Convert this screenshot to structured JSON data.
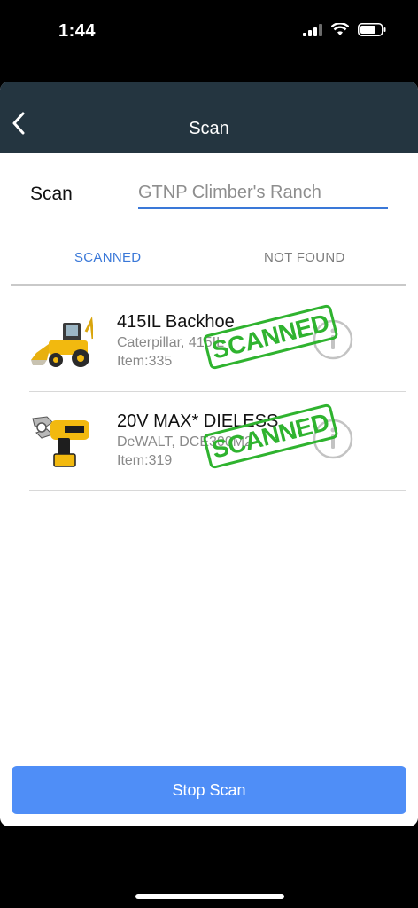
{
  "status": {
    "time": "1:44"
  },
  "nav": {
    "title": "Scan"
  },
  "scan": {
    "label": "Scan",
    "placeholder": "GTNP Climber's Ranch"
  },
  "tabs": {
    "scanned": "SCANNED",
    "not_found": "NOT FOUND"
  },
  "items": [
    {
      "title": "415IL Backhoe",
      "subtitle": "Caterpillar, 415IL",
      "item": "Item:335",
      "stamp": "SCANNED",
      "icon": "backhoe-image"
    },
    {
      "title": "20V MAX* DIELESS",
      "subtitle": "DeWALT, DCE300M2",
      "item": "Item:319",
      "stamp": "SCANNED",
      "icon": "crimping-tool-image"
    }
  ],
  "actions": {
    "stop_scan": "Stop Scan"
  },
  "colors": {
    "nav_bg": "#243540",
    "accent": "#3a78d8",
    "button": "#4f8ef7",
    "stamp": "#2fb32f"
  }
}
